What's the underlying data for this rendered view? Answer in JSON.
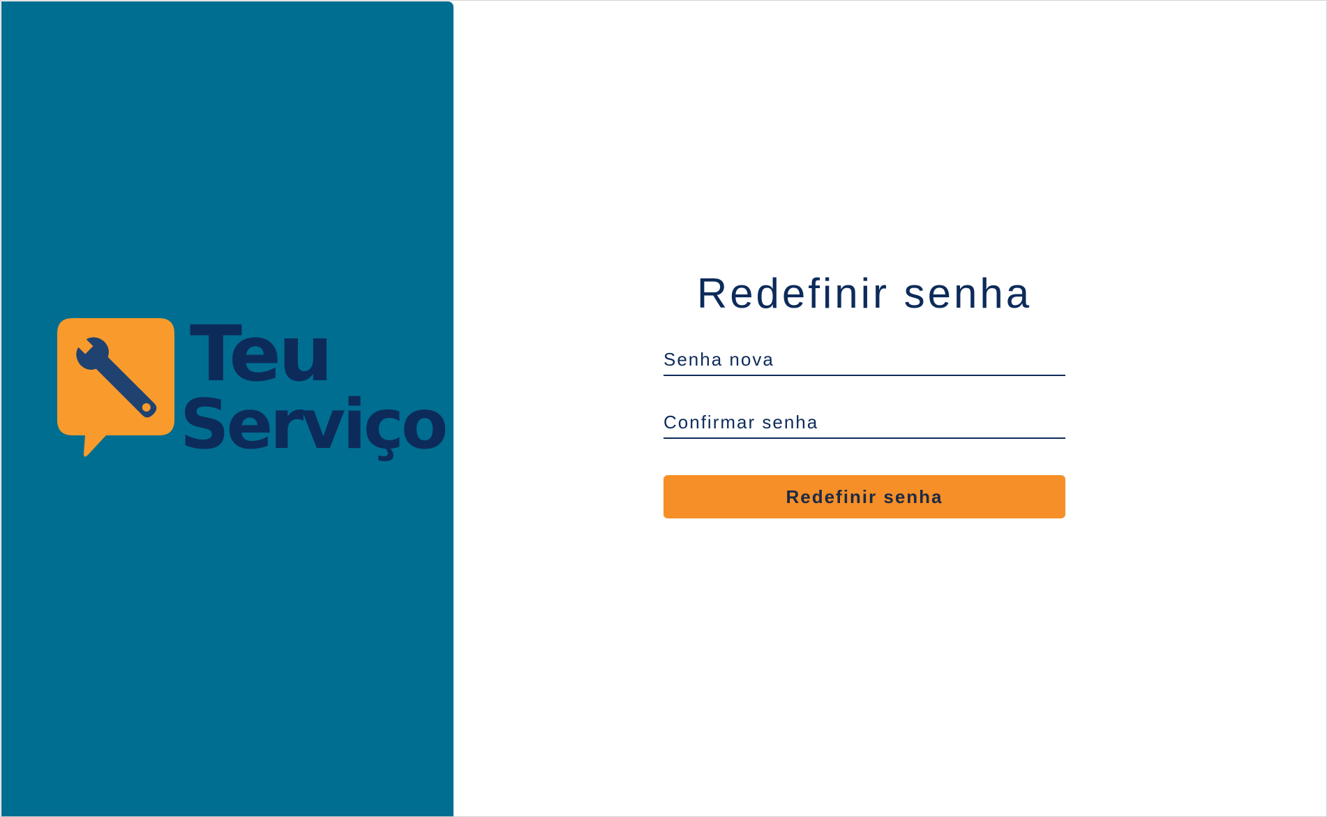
{
  "colors": {
    "brand_panel": "#006e91",
    "logo_orange": "#f89b2c",
    "logo_navy": "#0d2b5a",
    "text_navy": "#0d2b5a",
    "button_orange": "#f68f27",
    "background": "#ffffff"
  },
  "brand": {
    "logo_icon": "wrench-chat-bubble-icon",
    "name_line1": "Teu",
    "name_line2": "Serviço"
  },
  "form": {
    "title": "Redefinir senha",
    "new_password": {
      "placeholder": "Senha nova",
      "value": ""
    },
    "confirm_password": {
      "placeholder": "Confirmar senha",
      "value": ""
    },
    "submit_label": "Redefinir senha"
  }
}
